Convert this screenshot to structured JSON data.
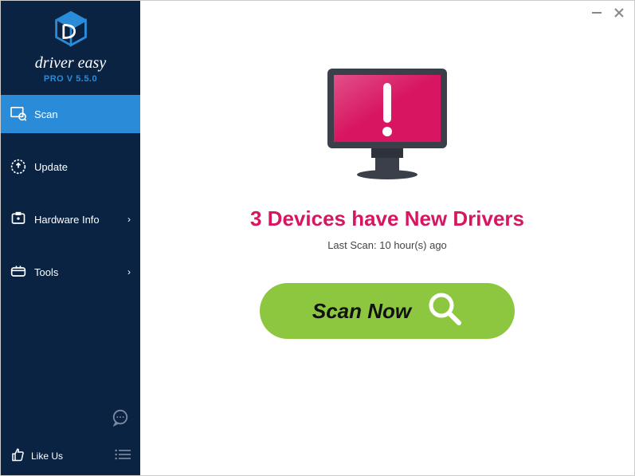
{
  "brand": {
    "name": "driver easy",
    "version": "PRO V 5.5.0"
  },
  "sidebar": {
    "items": [
      {
        "label": "Scan",
        "icon": "scan-icon",
        "active": true,
        "submenu": false
      },
      {
        "label": "Update",
        "icon": "update-icon",
        "active": false,
        "submenu": false
      },
      {
        "label": "Hardware Info",
        "icon": "hardware-info-icon",
        "active": false,
        "submenu": true
      },
      {
        "label": "Tools",
        "icon": "tools-icon",
        "active": false,
        "submenu": true
      }
    ],
    "like_label": "Like Us"
  },
  "main": {
    "headline": "3 Devices have New Drivers",
    "lastscan": "Last Scan: 10 hour(s) ago",
    "scan_button": "Scan Now"
  },
  "colors": {
    "sidebar_bg": "#0a2342",
    "accent": "#2a8cd8",
    "alert": "#d81560",
    "scan_btn": "#8dc63f"
  }
}
